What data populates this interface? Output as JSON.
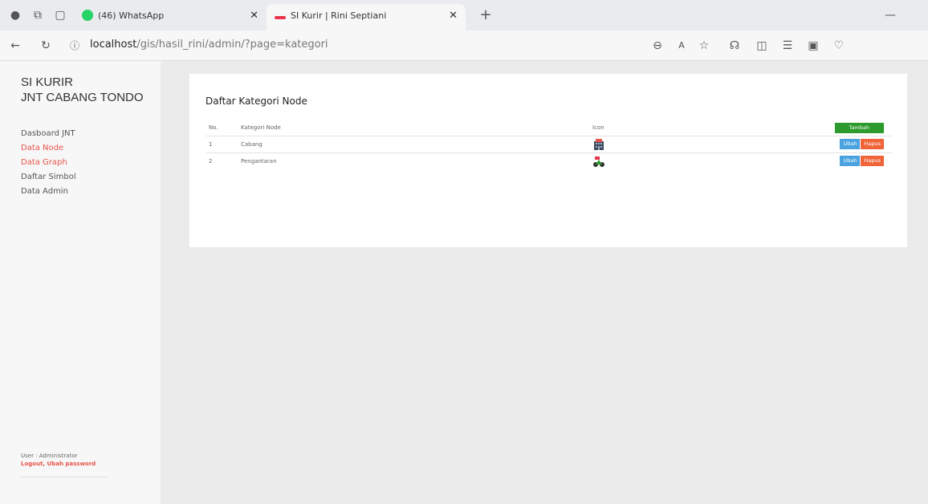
{
  "browser": {
    "tabs": [
      {
        "label": "(46) WhatsApp",
        "icon": "whatsapp-icon",
        "active": false
      },
      {
        "label": "SI Kurir | Rini Septiani",
        "icon": "site-favicon-icon",
        "active": true
      }
    ],
    "url_host": "localhost",
    "url_path": "/gis/hasil_rini/admin/?page=kategori"
  },
  "sidebar": {
    "brand_line1": "SI KURIR",
    "brand_line2": "JNT CABANG TONDO",
    "items": [
      {
        "label": "Dasboard JNT"
      },
      {
        "label": "Data Node"
      },
      {
        "label": "Data Graph"
      },
      {
        "label": "Daftar Simbol"
      },
      {
        "label": "Data Admin"
      }
    ],
    "user_label": "User : Administrator",
    "logout_label": "Logout",
    "change_password_label": "Ubah password"
  },
  "main": {
    "title": "Daftar Kategori Node",
    "table": {
      "headers": [
        "No.",
        "Kategori Node",
        "Icon"
      ],
      "add_label": "Tambah",
      "rows": [
        {
          "no": "1",
          "kategori": "Cabang",
          "icon": "building-icon",
          "edit": "Ubah",
          "delete": "Hapus"
        },
        {
          "no": "2",
          "kategori": "Pengantaran",
          "icon": "courier-scooter-icon",
          "edit": "Ubah",
          "delete": "Hapus"
        }
      ]
    }
  },
  "colors": {
    "accent_red": "#e8534a",
    "green": "#2c9a2c",
    "blue": "#4aa3df",
    "orange": "#f0643a"
  }
}
